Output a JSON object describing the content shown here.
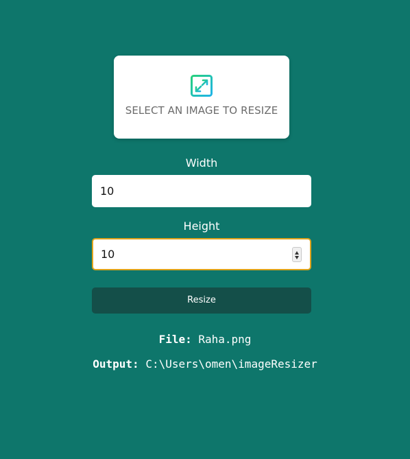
{
  "drop_zone": {
    "icon": "expand-arrows-icon",
    "label": "SELECT AN IMAGE TO RESIZE"
  },
  "width": {
    "label": "Width",
    "value": "10"
  },
  "height": {
    "label": "Height",
    "value": "10"
  },
  "resize_button": {
    "label": "Resize"
  },
  "file": {
    "key": "File:",
    "value": "Raha.png"
  },
  "output": {
    "key": "Output:",
    "value": "C:\\Users\\omen\\imageResizer"
  },
  "colors": {
    "background": "#0e766b",
    "button": "#144f49",
    "focus_border": "#e0a31a",
    "icon_gradient_start": "#26d07c",
    "icon_gradient_end": "#1fb4e8"
  }
}
